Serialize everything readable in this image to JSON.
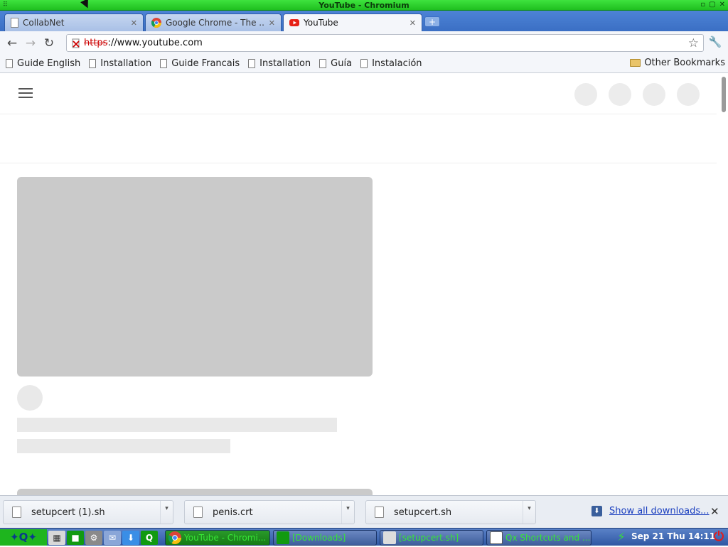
{
  "window": {
    "title": "YouTube - Chromium"
  },
  "tabs": [
    {
      "label": "CollabNet",
      "icon": "page-icon",
      "active": false
    },
    {
      "label": "Google Chrome - The ...",
      "icon": "chrome-icon",
      "active": false
    },
    {
      "label": "YouTube",
      "icon": "youtube-icon",
      "active": true
    }
  ],
  "toolbar": {
    "url_scheme": "https",
    "url_rest": "://www.youtube.com"
  },
  "bookmarks": [
    {
      "label": "Guide English"
    },
    {
      "label": "Installation"
    },
    {
      "label": "Guide Francais"
    },
    {
      "label": "Installation"
    },
    {
      "label": "Guía"
    },
    {
      "label": "Instalación"
    }
  ],
  "bookmarks_other": "Other Bookmarks",
  "downloads": [
    {
      "name": "setupcert (1).sh"
    },
    {
      "name": "penis.crt"
    },
    {
      "name": "setupcert.sh"
    }
  ],
  "downloads_show_all": "Show all downloads...",
  "taskbar": {
    "tasks": [
      {
        "label": "YouTube - Chromi...",
        "active": true
      },
      {
        "label": "[Downloads]",
        "active": false
      },
      {
        "label": "[setupcert.sh]",
        "active": false
      },
      {
        "label": "Qx Shortcuts and ...",
        "active": false
      }
    ],
    "clock": "Sep 21 Thu 14:11"
  },
  "colors": {
    "taskbar_green": "#1eb51e",
    "titlebar_green": "#3ee33e",
    "tabstrip_blue": "#4d83d6"
  }
}
